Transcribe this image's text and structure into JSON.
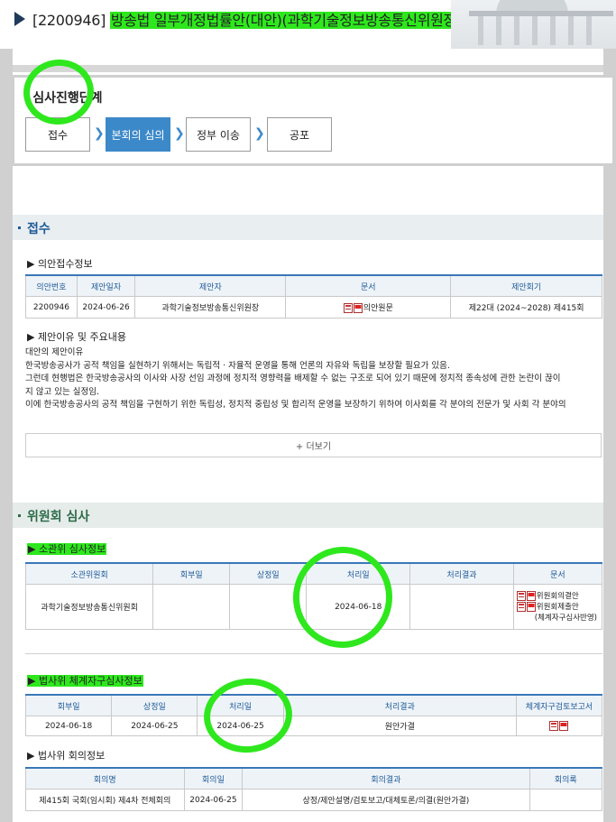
{
  "header": {
    "bill_id": "[2200946]",
    "bill_title": "방송법 일부개정법률안(대안)(과학기술정보방송통신위원장)"
  },
  "stage": {
    "title": "심사진행단계",
    "steps": [
      "접수",
      "본회의 심의",
      "정부 이송",
      "공포"
    ],
    "active_step": "본회의 심의"
  },
  "receipt_section": {
    "title": "접수",
    "info_title": "▶ 의안접수정보",
    "headers": [
      "의안번호",
      "제안일자",
      "제안자",
      "문서",
      "제안회기"
    ],
    "row": [
      "2200946",
      "2024-06-26",
      "과학기술정보방송통신위원장",
      "의안원문",
      "제22대 (2024~2028) 제415회"
    ],
    "reason_title": "▶ 제안이유 및 주요내용",
    "reason_lines": [
      "대안의 제안이유",
      "한국방송공사가 공적 책임을 실현하기 위해서는 독립적 · 자율적 운영을 통해 언론의 자유와 독립을 보장할 필요가 있음.",
      "그런데 현행법은 한국방송공사의 이사와 사장 선임 과정에 정치적 영향력을 배제할 수 없는 구조로 되어 있기 때문에 정치적 종속성에 관한 논란이 끊이",
      "지 않고 있는 실정임.",
      "이에 한국방송공사의 공적 책임을 구현하기 위한 독립성, 정치적 중립성 및 합리적 운영을 보장하기 위하여 이사회를 각 분야의 전문가 및 사회 각 분야의"
    ],
    "more_label": "+ 더보기"
  },
  "committee_section": {
    "title": "위원회 심사",
    "standing": {
      "title": "▶ 소관위 심사정보",
      "headers": [
        "소관위원회",
        "회부일",
        "상정일",
        "처리일",
        "처리결과",
        "문서"
      ],
      "row": [
        "과학기술정보방송통신위원회",
        "",
        "",
        "2024-06-18",
        ""
      ],
      "docs": [
        "위원회의결안",
        "위원회제출안",
        "(체계자구심사반영)"
      ]
    },
    "legislation": {
      "title": "▶ 법사위 체계자구심사정보",
      "headers": [
        "회부일",
        "상정일",
        "처리일",
        "처리결과",
        "체계자구검토보고서"
      ],
      "row": [
        "2024-06-18",
        "2024-06-25",
        "2024-06-25",
        "원안가결"
      ]
    },
    "meeting": {
      "title": "▶ 법사위 회의정보",
      "headers": [
        "회의명",
        "회의일",
        "회의결과",
        "회의록"
      ],
      "row": [
        "제415회 국회(임시회) 제4차 전체회의",
        "2024-06-25",
        "상정/제안설명/검토보고/대체토론/의결(원안가결)",
        ""
      ]
    }
  },
  "colors": {
    "highlight": "#2ee81d",
    "active_step": "#3c89c9",
    "header_text": "#1e5a96",
    "section_green": "#2d6b4a"
  },
  "icons": [
    "chevron-right-icon",
    "hwp-file-icon",
    "pdf-file-icon"
  ]
}
